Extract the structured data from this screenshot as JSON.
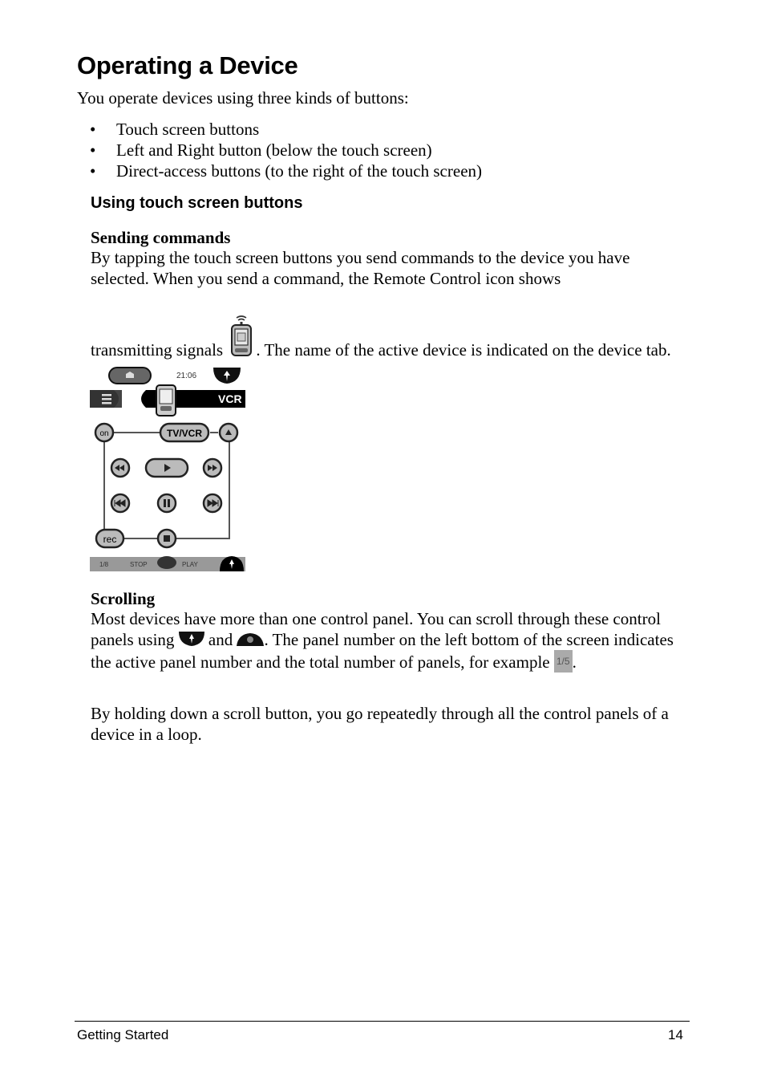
{
  "page": {
    "title": "Operating a Device",
    "intro": "You operate devices using three kinds of buttons:",
    "bullet_glyph": "•",
    "bullets": [
      "Touch screen buttons",
      "Left and Right button (below the touch screen)",
      "Direct-access buttons (to the right of the touch screen)"
    ],
    "section": {
      "heading": "Using touch screen buttons",
      "sending": {
        "heading": "Sending commands",
        "text_1": "By tapping the touch screen buttons you send commands to the device you have selected. When you send a command, the Remote Control icon shows",
        "text_2a": "transmitting signals",
        "text_2b": ". The name of the active device is indicated on the device tab.",
        "icon": "remote-transmitting-icon"
      },
      "screen": {
        "time": "21:06",
        "device_tab": "VCR",
        "buttons": {
          "on": "on",
          "tv_vcr": "TV/VCR",
          "rec": "rec"
        },
        "status_bar": {
          "panel": "1/8",
          "left_label": "STOP",
          "right_label": "PLAY"
        }
      },
      "scrolling": {
        "heading": "Scrolling",
        "text_1a": "Most devices have more than one control panel. You can scroll through these control panels using",
        "text_1b": "and",
        "text_1c": ". The panel number on the left bottom of the screen indicates the active panel number and the total number of panels, for example",
        "text_1d": ".",
        "example_panel": "1/5",
        "text_2": "By holding down a scroll button, you go repeatedly through all the control panels of a device in a loop."
      }
    },
    "footer": {
      "left": "Getting Started",
      "page_number": "14"
    }
  }
}
